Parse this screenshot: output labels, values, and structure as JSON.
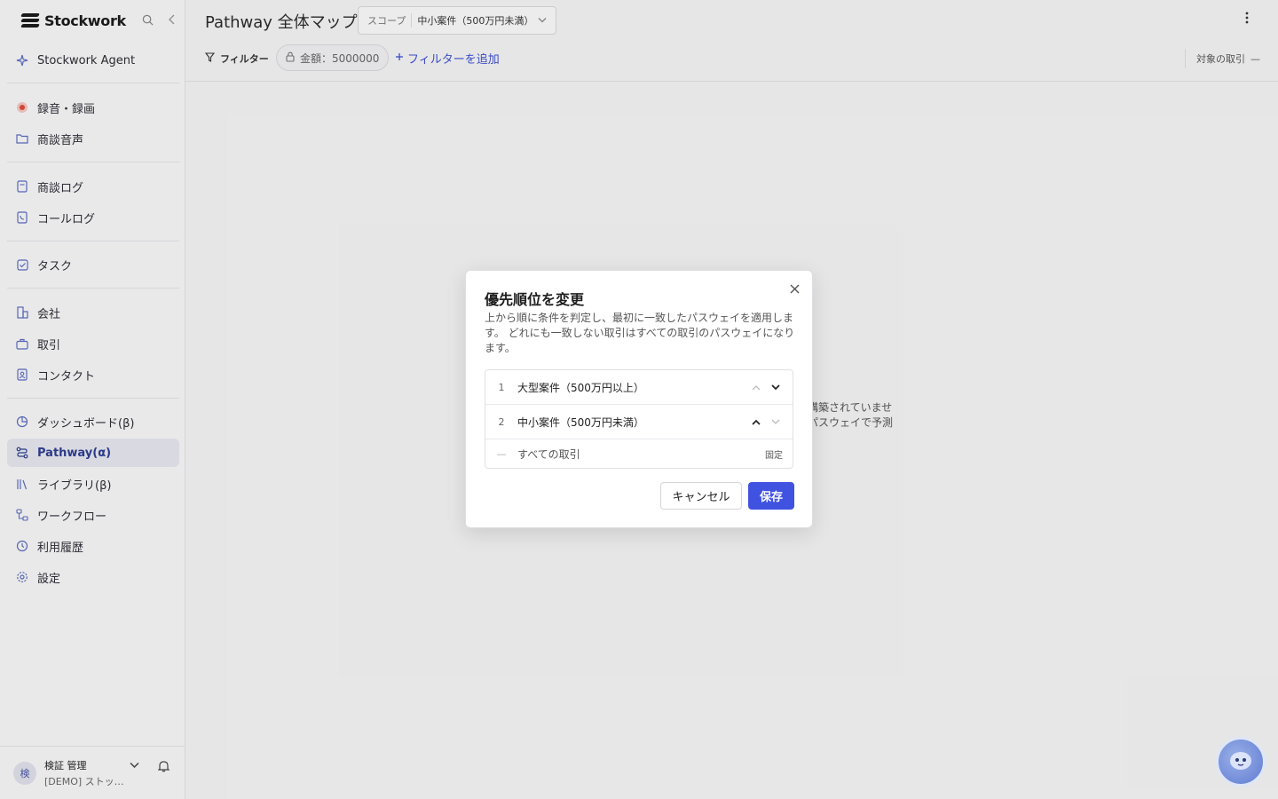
{
  "app": {
    "brand": "Stockwork"
  },
  "sidebar": {
    "agent": "Stockwork Agent",
    "items": [
      {
        "label": "録音・録画",
        "icon": "record-icon"
      },
      {
        "label": "商談音声",
        "icon": "folder-icon"
      },
      {
        "label": "商談ログ",
        "icon": "document-icon"
      },
      {
        "label": "コールログ",
        "icon": "phone-icon"
      },
      {
        "label": "タスク",
        "icon": "checkbox-icon"
      },
      {
        "label": "会社",
        "icon": "building-icon"
      },
      {
        "label": "取引",
        "icon": "briefcase-icon"
      },
      {
        "label": "コンタクト",
        "icon": "contact-icon"
      },
      {
        "label": "ダッシュボード(β)",
        "icon": "dashboard-icon"
      },
      {
        "label": "Pathway(α)",
        "icon": "pathway-icon",
        "active": true
      },
      {
        "label": "ライブラリ(β)",
        "icon": "library-icon"
      },
      {
        "label": "ワークフロー",
        "icon": "workflow-icon"
      },
      {
        "label": "利用履歴",
        "icon": "history-icon"
      },
      {
        "label": "設定",
        "icon": "gear-icon"
      }
    ],
    "user": {
      "avatar": "検",
      "name": "検証 管理",
      "org": "[DEMO] ストックワーク"
    }
  },
  "header": {
    "title": "Pathway 全体マップ",
    "scope_label": "スコープ",
    "scope_value": "中小案件（500万円未満）"
  },
  "filterbar": {
    "filter_label": "フィルター",
    "chip": "金額：5000000",
    "add_filter": "フィルターを追加",
    "target_deals": "対象の取引",
    "target_value": "—"
  },
  "background": {
    "line1": "構築されていませ",
    "line2": "パスウェイで予測"
  },
  "modal": {
    "title": "優先順位を変更",
    "description": "上から順に条件を判定し、最初に一致したパスウェイを適用します。 どれにも一致しない取引はすべての取引のパスウェイになります。",
    "rows": [
      {
        "no": "1",
        "name": "大型案件（500万円以上）"
      },
      {
        "no": "2",
        "name": "中小案件（500万円未満）"
      }
    ],
    "fixed_row": {
      "no": "—",
      "name": "すべての取引",
      "badge": "固定"
    },
    "cancel": "キャンセル",
    "save": "保存"
  },
  "colors": {
    "accent": "#4052e0",
    "active_nav": "#2e3d8f"
  }
}
